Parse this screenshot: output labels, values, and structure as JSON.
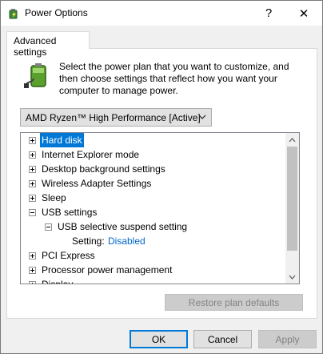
{
  "window": {
    "title": "Power Options",
    "help_label": "?",
    "close_label": "✕"
  },
  "tabs": [
    {
      "label": "Advanced settings",
      "active": true
    }
  ],
  "description": "Select the power plan that you want to customize, and then choose settings that reflect how you want your computer to manage power.",
  "plan_dropdown": {
    "selected": "AMD Ryzen™ High Performance [Active]"
  },
  "tree": {
    "items": [
      {
        "label": "Hard disk",
        "expander": "plus",
        "selected": true
      },
      {
        "label": "Internet Explorer mode",
        "expander": "plus"
      },
      {
        "label": "Desktop background settings",
        "expander": "plus"
      },
      {
        "label": "Wireless Adapter Settings",
        "expander": "plus"
      },
      {
        "label": "Sleep",
        "expander": "plus"
      },
      {
        "label": "USB settings",
        "expander": "minus"
      },
      {
        "label": "USB selective suspend setting",
        "expander": "minus",
        "level": 1
      },
      {
        "label": "Setting:",
        "value": "Disabled",
        "level": 2
      },
      {
        "label": "PCI Express",
        "expander": "plus"
      },
      {
        "label": "Processor power management",
        "expander": "plus"
      },
      {
        "label": "Display",
        "expander": "plus"
      }
    ]
  },
  "buttons": {
    "restore": "Restore plan defaults",
    "ok": "OK",
    "cancel": "Cancel",
    "apply": "Apply"
  },
  "colors": {
    "selection": "#0078d7",
    "link_value": "#0066cc",
    "accent_border": "#0078d7"
  },
  "icons": {
    "title": "power-options-icon",
    "battery": "battery-plug-icon"
  }
}
